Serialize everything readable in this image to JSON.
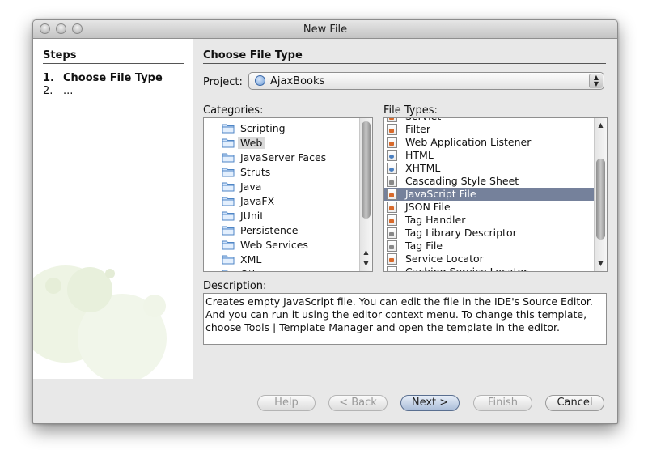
{
  "window": {
    "title": "New File"
  },
  "steps": {
    "heading": "Steps",
    "items": [
      {
        "num": "1.",
        "label": "Choose File Type"
      },
      {
        "num": "2.",
        "label": "..."
      }
    ]
  },
  "main": {
    "heading": "Choose File Type",
    "project_label": "Project:",
    "project_value": "AjaxBooks"
  },
  "categories": {
    "label": "Categories:",
    "items": [
      "Scripting",
      "Web",
      "JavaServer Faces",
      "Struts",
      "Java",
      "JavaFX",
      "JUnit",
      "Persistence",
      "Web Services",
      "XML",
      "Other"
    ],
    "selected": "Web"
  },
  "file_types": {
    "label": "File Types:",
    "items": [
      "Servlet",
      "Filter",
      "Web Application Listener",
      "HTML",
      "XHTML",
      "Cascading Style Sheet",
      "JavaScript File",
      "JSON File",
      "Tag Handler",
      "Tag Library Descriptor",
      "Tag File",
      "Service Locator",
      "Caching Service Locator"
    ],
    "selected": "JavaScript File"
  },
  "description": {
    "label": "Description:",
    "text": "Creates empty JavaScript file. You can edit the file in the IDE's Source Editor. And you can run it using the editor context menu. To change this template, choose Tools | Template Manager and open the template in the editor."
  },
  "buttons": {
    "help": "Help",
    "back": "< Back",
    "next": "Next >",
    "finish": "Finish",
    "cancel": "Cancel"
  }
}
